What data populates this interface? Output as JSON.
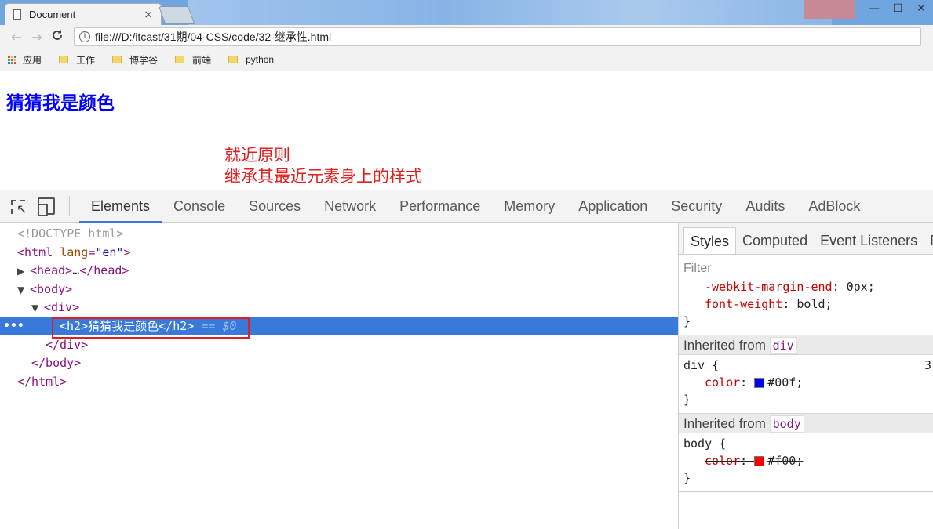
{
  "browser": {
    "tab_title": "Document",
    "tab_close": "×",
    "window_controls": [
      "—",
      "☐",
      "✕"
    ],
    "nav": {
      "back": "←",
      "forward": "→",
      "reload": "C"
    },
    "url": "file:///D:/itcast/31期/04-CSS/code/32-继承性.html",
    "info_icon": "i",
    "bookmarks": [
      {
        "label": "应用",
        "icon": "apps-icon"
      },
      {
        "label": "工作",
        "icon": "folder-icon"
      },
      {
        "label": "博学谷",
        "icon": "folder-icon"
      },
      {
        "label": "前端",
        "icon": "folder-icon"
      },
      {
        "label": "python",
        "icon": "folder-icon"
      }
    ],
    "apps_colors": [
      "#e8453c",
      "#f9bb2d",
      "#3a7ae0",
      "#34a853",
      "#e8453c",
      "#f9bb2d",
      "#3a7ae0",
      "#34a853",
      "#e8453c"
    ]
  },
  "page": {
    "heading": "猜猜我是颜色",
    "heading_color": "#0000ff",
    "note_line1": "就近原则",
    "note_line2": "继承其最近元素身上的样式",
    "note_color": "#e02020"
  },
  "devtools": {
    "tabs": [
      "Elements",
      "Console",
      "Sources",
      "Network",
      "Performance",
      "Memory",
      "Application",
      "Security",
      "Audits",
      "AdBlock"
    ],
    "active_tab": "Elements",
    "dom": {
      "doctype": "<!DOCTYPE html>",
      "html_open": "<html",
      "html_attr": "lang",
      "html_attr_val": "\"en\"",
      "html_open_end": ">",
      "head_open": "<head>",
      "head_ellipsis": "…",
      "head_close": "</head>",
      "body_open": "<body>",
      "div_open": "<div>",
      "h2_open": "<h2>",
      "h2_text": "猜猜我是颜色",
      "h2_close": "</h2>",
      "eq_marker": "== $0",
      "div_close": "</div>",
      "body_close": "</body>",
      "html_close": "</html>",
      "ellipsis": "•••"
    },
    "styles": {
      "tabs": [
        "Styles",
        "Computed",
        "Event Listeners",
        "D"
      ],
      "filter_placeholder": "Filter",
      "rule1": {
        "prop1": "-webkit-margin-end",
        "val1": "0px;",
        "prop2": "font-weight",
        "val2": "bold;",
        "close": "}"
      },
      "inherit_div": {
        "label": "Inherited from",
        "node": "div"
      },
      "rule_div": {
        "selector": "div {",
        "prop": "color",
        "swatch": "#0000ff",
        "value": "#00f;",
        "close": "}",
        "source": "3"
      },
      "inherit_body": {
        "label": "Inherited from",
        "node": "body"
      },
      "rule_body": {
        "selector": "body {",
        "prop": "color",
        "swatch": "#ff0000",
        "value": "#f00;",
        "close": "}"
      }
    }
  }
}
